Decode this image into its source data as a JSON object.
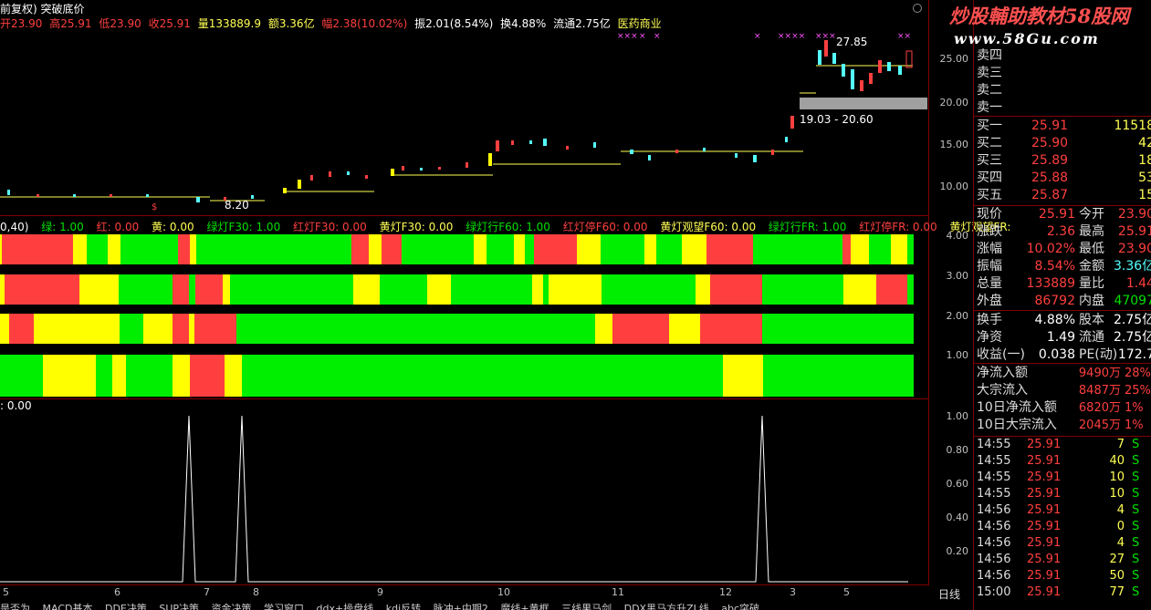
{
  "header": {
    "title": "前复权) 突破底价",
    "open": "开23.90",
    "high": "高25.91",
    "low": "低23.90",
    "close": "收25.91",
    "volume": "量133889.9",
    "amount": "额3.36亿",
    "range": "幅2.38(10.02%)",
    "amplitude": "振2.01(8.54%)",
    "turnover": "换4.88%",
    "float": "流通2.75亿",
    "sector": "医药商业"
  },
  "watermark": {
    "line1": "炒股輔助教材58股网",
    "line2": "www.58Gu.com"
  },
  "price_axis": [
    "25.00",
    "20.00",
    "15.00",
    "10.00"
  ],
  "indicator_axis": [
    "4.00",
    "3.00",
    "2.00",
    "1.00"
  ],
  "bottom_axis": [
    "1.00",
    "0.80",
    "0.60",
    "0.40",
    "0.20"
  ],
  "annotations": {
    "high_label": "27.85",
    "range_label": "19.03 - 20.60",
    "low_label": "8.20",
    "bottom_value": ": 0.00"
  },
  "indicator_header": {
    "params": "0,40)",
    "green": "绿: 1.00",
    "red": "红: 0.00",
    "yellow": "黄: 0.00",
    "f30_green": "绿灯F30: 1.00",
    "f30_red": "红灯F30: 0.00",
    "f30_yellow": "黄灯F30: 0.00",
    "f60_green": "绿灯行F60: 1.00",
    "f60_red": "红灯停F60: 0.00",
    "f60_yellow": "黄灯观望F60: 0.00",
    "fr_green": "绿灯行FR: 1.00",
    "fr_red": "红灯停FR: 0.00",
    "fr_yellow": "黄灯观望FR:"
  },
  "date_axis": [
    "5",
    "6",
    "7",
    "8",
    "9",
    "10",
    "11",
    "12",
    "3",
    "5"
  ],
  "tabs": [
    "是否为",
    "MACD基本",
    "DDE决策",
    "SUP决策",
    "资金决策",
    "学习窗口",
    "ddx+操盘线",
    "kdj反转",
    "脉冲+中期2",
    "魔线+黄框",
    "三线果马剑",
    "DDX黑马方升ZL线",
    "abc突破"
  ],
  "order_book": {
    "asks_overlay": [
      "卖四",
      "卖三",
      "卖二",
      "卖一"
    ],
    "bids": [
      {
        "label": "买一",
        "price": "25.91",
        "vol": "11518"
      },
      {
        "label": "买二",
        "price": "25.90",
        "vol": "42"
      },
      {
        "label": "买三",
        "price": "25.89",
        "vol": "18"
      },
      {
        "label": "买四",
        "price": "25.88",
        "vol": "53"
      },
      {
        "label": "买五",
        "price": "25.87",
        "vol": "15"
      }
    ]
  },
  "quote": [
    {
      "l1": "现价",
      "v1": "25.91",
      "l2": "今开",
      "v2": "23.90"
    },
    {
      "l1": "涨跌",
      "v1": "2.36",
      "l2": "最高",
      "v2": "25.91"
    },
    {
      "l1": "涨幅",
      "v1": "10.02%",
      "l2": "最低",
      "v2": "23.90"
    },
    {
      "l1": "振幅",
      "v1": "8.54%",
      "l2": "金额",
      "v2": "3.36亿"
    },
    {
      "l1": "总量",
      "v1": "133889",
      "l2": "量比",
      "v2": "1.44"
    },
    {
      "l1": "外盘",
      "v1": "86792",
      "l2": "内盘",
      "v2": "47097"
    }
  ],
  "stock_info": [
    {
      "l1": "换手",
      "v1": "4.88%",
      "l2": "股本",
      "v2": "2.75亿"
    },
    {
      "l1": "净资",
      "v1": "1.49",
      "l2": "流通",
      "v2": "2.75亿"
    },
    {
      "l1": "收益(一)",
      "v1": "0.038",
      "l2": "PE(动)",
      "v2": "172.7"
    }
  ],
  "flows": [
    {
      "label": "净流入额",
      "value": "9490万",
      "pct": "28%"
    },
    {
      "label": "大宗流入",
      "value": "8487万",
      "pct": "25%"
    },
    {
      "label": "10日净流入额",
      "value": "6820万",
      "pct": "1%"
    },
    {
      "label": "10日大宗流入",
      "value": "2045万",
      "pct": "1%"
    }
  ],
  "ticks": [
    {
      "time": "14:55",
      "price": "25.91",
      "vol": "7",
      "side": "S"
    },
    {
      "time": "14:55",
      "price": "25.91",
      "vol": "40",
      "side": "S"
    },
    {
      "time": "14:55",
      "price": "25.91",
      "vol": "10",
      "side": "S"
    },
    {
      "time": "14:55",
      "price": "25.91",
      "vol": "10",
      "side": "S"
    },
    {
      "time": "14:56",
      "price": "25.91",
      "vol": "4",
      "side": "S"
    },
    {
      "time": "14:56",
      "price": "25.91",
      "vol": "0",
      "side": "S"
    },
    {
      "time": "14:56",
      "price": "25.91",
      "vol": "4",
      "side": "S"
    },
    {
      "time": "14:56",
      "price": "25.91",
      "vol": "27",
      "side": "S"
    },
    {
      "time": "14:56",
      "price": "25.91",
      "vol": "50",
      "side": "S"
    },
    {
      "time": "15:00",
      "price": "25.91",
      "vol": "77",
      "side": "S"
    }
  ],
  "period_label": "日线",
  "colors": {
    "red": "#ff3f3f",
    "green": "#00ee00",
    "yellow": "#ffff00",
    "panel_border": "#800000"
  },
  "bars": {
    "row1": [
      [
        "y",
        0,
        2
      ],
      [
        "r",
        2,
        80
      ],
      [
        "y",
        80,
        95
      ],
      [
        "g",
        95,
        118
      ],
      [
        "y",
        118,
        132
      ],
      [
        "g",
        132,
        195
      ],
      [
        "r",
        195,
        208
      ],
      [
        "y",
        208,
        215
      ],
      [
        "g",
        215,
        385
      ],
      [
        "r",
        385,
        404
      ],
      [
        "y",
        404,
        418
      ],
      [
        "r",
        418,
        440
      ],
      [
        "g",
        440,
        519
      ],
      [
        "y",
        519,
        533
      ],
      [
        "g",
        533,
        563
      ],
      [
        "y",
        563,
        575
      ],
      [
        "g",
        575,
        585
      ],
      [
        "r",
        585,
        601
      ],
      [
        "r",
        601,
        632
      ],
      [
        "y",
        632,
        658
      ],
      [
        "g",
        658,
        706
      ],
      [
        "y",
        706,
        719
      ],
      [
        "g",
        719,
        747
      ],
      [
        "y",
        747,
        774
      ],
      [
        "r",
        774,
        825
      ],
      [
        "g",
        825,
        923
      ],
      [
        "r",
        923,
        932
      ],
      [
        "y",
        932,
        952
      ],
      [
        "g",
        952,
        976
      ],
      [
        "y",
        976,
        994
      ],
      [
        "g",
        994,
        1001
      ]
    ],
    "row2": [
      [
        "y",
        0,
        5
      ],
      [
        "r",
        5,
        87
      ],
      [
        "y",
        87,
        130
      ],
      [
        "g",
        130,
        189
      ],
      [
        "r",
        189,
        207
      ],
      [
        "g",
        207,
        214
      ],
      [
        "r",
        214,
        244
      ],
      [
        "y",
        244,
        252
      ],
      [
        "g",
        252,
        387
      ],
      [
        "y",
        387,
        416
      ],
      [
        "g",
        416,
        468
      ],
      [
        "y",
        468,
        494
      ],
      [
        "g",
        494,
        583
      ],
      [
        "y",
        583,
        595
      ],
      [
        "g",
        595,
        601
      ],
      [
        "y",
        601,
        659
      ],
      [
        "g",
        659,
        762
      ],
      [
        "y",
        762,
        778
      ],
      [
        "r",
        778,
        835
      ],
      [
        "g",
        835,
        924
      ],
      [
        "y",
        924,
        960
      ],
      [
        "r",
        960,
        994
      ],
      [
        "g",
        994,
        1001
      ]
    ],
    "row3": [
      [
        "y",
        0,
        10
      ],
      [
        "r",
        10,
        37
      ],
      [
        "y",
        37,
        131
      ],
      [
        "g",
        131,
        157
      ],
      [
        "y",
        157,
        189
      ],
      [
        "r",
        189,
        207
      ],
      [
        "y",
        207,
        213
      ],
      [
        "r",
        213,
        259
      ],
      [
        "g",
        259,
        652
      ],
      [
        "y",
        652,
        671
      ],
      [
        "r",
        671,
        733
      ],
      [
        "y",
        733,
        767
      ],
      [
        "r",
        767,
        835
      ],
      [
        "g",
        835,
        1001
      ]
    ],
    "row4": [
      [
        "g",
        0,
        47
      ],
      [
        "y",
        47,
        105
      ],
      [
        "g",
        105,
        123
      ],
      [
        "y",
        123,
        138
      ],
      [
        "g",
        138,
        189
      ],
      [
        "y",
        189,
        208
      ],
      [
        "r",
        208,
        246
      ],
      [
        "y",
        246,
        265
      ],
      [
        "g",
        265,
        792
      ],
      [
        "y",
        792,
        836
      ],
      [
        "g",
        836,
        1001
      ]
    ]
  }
}
